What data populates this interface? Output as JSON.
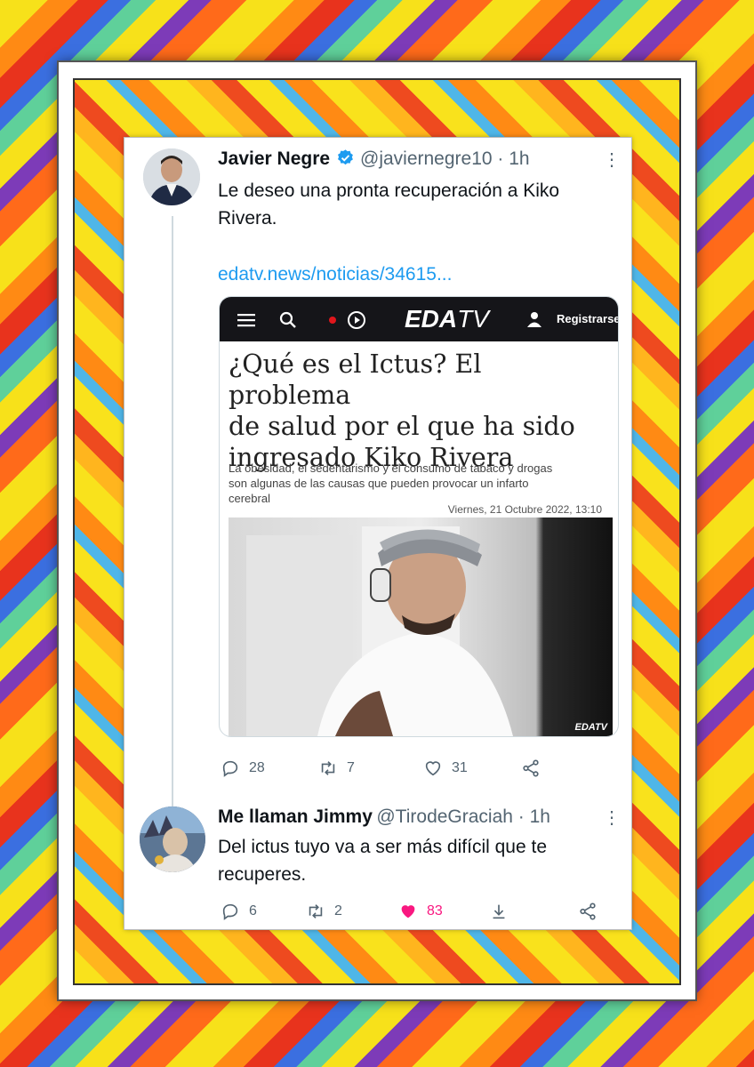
{
  "tweet1": {
    "name": "Javier Negre",
    "handle": "@javiernegre10 · 1h",
    "text_line1": "Le deseo una pronta recuperación a Kiko",
    "text_line2": "Rivera.",
    "link": "edatv.news/noticias/34615...",
    "card": {
      "brand": "EDA",
      "brand_tv": "TV",
      "register": "Registrarse",
      "headline_l1": "¿Qué es el Ictus? El problema",
      "headline_l2": "de salud por el que ha sido",
      "headline_l3": "ingresado Kiko Rivera",
      "sub_l1": "La obesidad, el sedentarismo y el consumo de tabaco y drogas",
      "sub_l2": "son algunas de las causas que pueden provocar un infarto",
      "sub_l3": "cerebral",
      "date": "Viernes, 21 Octubre 2022, 13:10",
      "photo_watermark": "EDATV"
    },
    "replies": "28",
    "retweets": "7",
    "likes": "31"
  },
  "tweet2": {
    "name": "Me llaman Jimmy",
    "handle": "@TirodeGraciah · 1h",
    "text_line1": "Del ictus tuyo va a ser más difícil que te",
    "text_line2": "recuperes.",
    "replies": "6",
    "retweets": "2",
    "likes": "83"
  },
  "colors": {
    "link": "#1d9bf0",
    "liked": "#f91880",
    "verified": "#1d9bf0"
  }
}
